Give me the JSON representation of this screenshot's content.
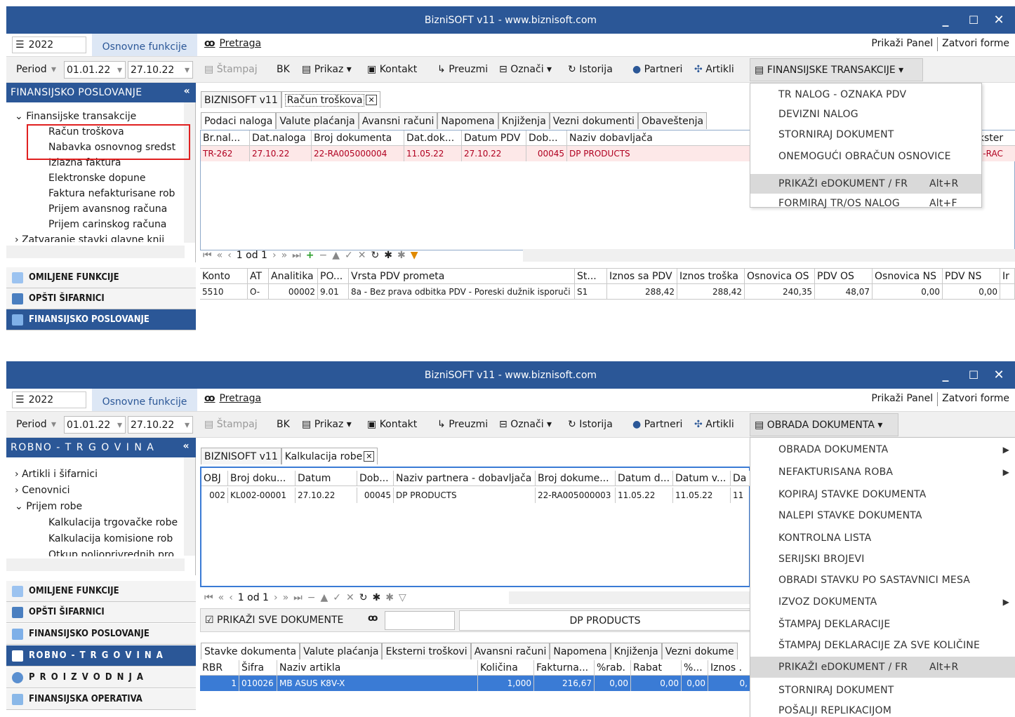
{
  "app_title": "BizniSOFT v11 - www.biznisoft.com",
  "window_controls": {
    "minimize": "_",
    "maximize": "☐",
    "close": "✕"
  },
  "year": "2022",
  "main_tab": "Osnovne funkcije",
  "search": "Pretraga",
  "show_panel": "Prikaži Panel",
  "close_forms": "Zatvori forme",
  "period_label": "Period",
  "date_from": "01.01.22",
  "date_to": "27.10.22",
  "toolbar": {
    "print": "Štampaj",
    "bk": "BK",
    "view": "Prikaz",
    "contact": "Kontakt",
    "download": "Preuzmi",
    "mark": "Označi",
    "history": "Istorija",
    "partners": "Partneri",
    "articles": "Artikli"
  },
  "nav_common": {
    "favorites": "OMILJENE FUNKCIJE",
    "general_codes": "OPŠTI ŠIFARNICI",
    "finance": "FINANSIJSKO POSLOVANJE",
    "retail": "ROBNO - T R G O V I N A",
    "production": "P R O I Z V O D N J A",
    "fin_operative": "FINANSIJSKA OPERATIVA"
  },
  "screen1": {
    "panel_title": "FINANSIJSKO POSLOVANJE",
    "tree": [
      "Finansijske transakcije",
      "Račun troškova",
      "Nabavka osnovnog sredst",
      "Izlazna faktura",
      "Elektronske dopune",
      "Faktura nefakturisane rob",
      "Prijem avansnog računa",
      "Prijem carinskog računa",
      "Zatvaranje stavki glavne knji"
    ],
    "doc_tabs": [
      "BIZNISOFT v11",
      "Račun troškova"
    ],
    "sub_tabs": [
      "Podaci naloga",
      "Valute plaćanja",
      "Avansni računi",
      "Napomena",
      "Knjiženja",
      "Vezni dokumenti",
      "Obaveštenja"
    ],
    "grid_headers": [
      "Br.nal...",
      "Dat.naloga",
      "Broj dokumenta",
      "Dat.dok...",
      "Datum PDV",
      "Dob...",
      "Naziv dobavljača",
      "Ekster"
    ],
    "grid_row": [
      "TR-262",
      "27.10.22",
      "22-RA005000004",
      "11.05.22",
      "27.10.22",
      "00045",
      "DP PRODUCTS",
      "22-RAC"
    ],
    "pager": "1 od 1",
    "lower_headers": [
      "Konto",
      "AT",
      "Analitika",
      "PO...",
      "Vrsta PDV prometa",
      "St...",
      "Iznos sa PDV",
      "Iznos troška",
      "Osnovica OS",
      "PDV OS",
      "Osnovica NS",
      "PDV NS",
      "Ir"
    ],
    "lower_row": [
      "5510",
      "O-",
      "00002",
      "9.01",
      "8a - Bez prava odbitka PDV - Poreski dužnik isporuči",
      "S1",
      "288,42",
      "288,42",
      "240,35",
      "48,07",
      "0,00",
      "0,00",
      ""
    ],
    "dropdown_button": "FINANSIJSKE TRANSAKCIJE",
    "menu": [
      {
        "label": "TR NALOG - OZNAKA PDV",
        "shortcut": ""
      },
      {
        "label": "DEVIZNI NALOG",
        "shortcut": ""
      },
      {
        "label": "STORNIRAJ DOKUMENT",
        "shortcut": ""
      },
      {
        "label": "ONEMOGUĆI OBRAČUN OSNOVICE",
        "shortcut": ""
      },
      {
        "label": "PRIKAŽI eDOKUMENT / FR",
        "shortcut": "Alt+R"
      },
      {
        "label": "FORMIRAJ TR/OS NALOG",
        "shortcut": "Alt+F"
      }
    ]
  },
  "screen2": {
    "panel_title": "ROBNO - T R G O V I N A",
    "tree": [
      "Artikli i šifarnici",
      "Cenovnici",
      "Prijem robe",
      "Kalkulacija trgovačke robe",
      "Kalkulacija komisione rob",
      "Otkup poljoprivrednih pro"
    ],
    "doc_tabs": [
      "BIZNISOFT v11",
      "Kalkulacija robe"
    ],
    "grid_headers": [
      "OBJ",
      "Broj doku...",
      "Datum",
      "Dob...",
      "Naziv partnera - dobavljača",
      "Broj dokume...",
      "Datum d...",
      "Datum v...",
      "Da"
    ],
    "grid_row": [
      "002",
      "KL002-00001",
      "27.10.22",
      "00045",
      "DP PRODUCTS",
      "22-RA005000003",
      "11.05.22",
      "11.05.22",
      "11"
    ],
    "pager": "1 od 1",
    "show_all": "PRIKAŽI SVE DOKUMENTE",
    "partner_display": "DP PRODUCTS",
    "sub_tabs": [
      "Stavke dokumenta",
      "Valute plaćanja",
      "Eksterni troškovi",
      "Avansni računi",
      "Napomena",
      "Knjiženja",
      "Vezni dokume"
    ],
    "item_headers": [
      "RBR",
      "Šifra",
      "Naziv artikla",
      "Količina",
      "Fakturna...",
      "%rab.",
      "Rabat",
      "%...",
      "Iznos ."
    ],
    "item_row": [
      "1",
      "010026",
      "MB ASUS K8V-X",
      "1,000",
      "216,67",
      "0,00",
      "0,00",
      "0,00",
      "0,"
    ],
    "dropdown_button": "OBRADA DOKUMENTA",
    "menu": [
      {
        "label": "OBRADA DOKUMENTA",
        "shortcut": "",
        "sub": true
      },
      {
        "label": "NEFAKTURISANA ROBA",
        "shortcut": "",
        "sub": true
      },
      {
        "label": "KOPIRAJ STAVKE DOKUMENTA",
        "shortcut": ""
      },
      {
        "label": "NALEPI STAVKE DOKUMENTA",
        "shortcut": ""
      },
      {
        "label": "KONTROLNA LISTA",
        "shortcut": ""
      },
      {
        "label": "SERIJSKI BROJEVI",
        "shortcut": ""
      },
      {
        "label": "OBRADI STAVKU PO SASTAVNICI MESA",
        "shortcut": ""
      },
      {
        "label": "IZVOZ DOKUMENTA",
        "shortcut": "",
        "sub": true
      },
      {
        "label": "ŠTAMPAJ DEKLARACIJE",
        "shortcut": ""
      },
      {
        "label": "ŠTAMPAJ DEKLARACIJE ZA SVE KOLIČINE",
        "shortcut": ""
      },
      {
        "label": "PRIKAŽI eDOKUMENT / FR",
        "shortcut": "Alt+R"
      },
      {
        "label": "STORNIRAJ DOKUMENT",
        "shortcut": ""
      },
      {
        "label": "POŠALJI REPLIKACIJOM",
        "shortcut": ""
      }
    ]
  },
  "colors": {
    "titlebar": "#2b5797",
    "selection": "#3a7bd5",
    "highlight": "#d9d9d9",
    "red_box": "#e02020"
  }
}
